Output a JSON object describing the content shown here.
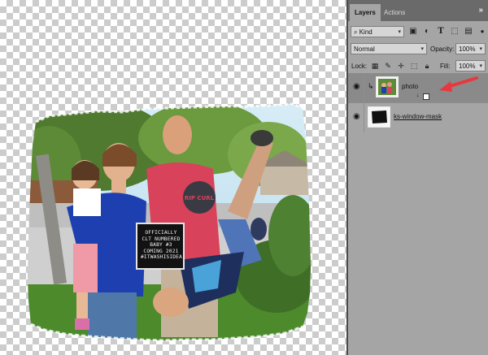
{
  "letterboard": {
    "lines": [
      "OFFICIALLY",
      "CLT NUMBERED",
      "BABY #3",
      "COMING 2021",
      "#ITWASHISIDEA"
    ]
  },
  "panel": {
    "tabs": [
      {
        "label": "Layers"
      },
      {
        "label": "Actions"
      }
    ],
    "menu_glyph": "»",
    "filter": {
      "value": "Kind",
      "icons": [
        "image-filter-icon",
        "adjustment-filter-icon",
        "type-filter-icon",
        "shape-filter-icon",
        "smartobject-filter-icon"
      ]
    },
    "blend_mode": "Normal",
    "opacity": {
      "label": "Opacity:",
      "value": "100%"
    },
    "lock": {
      "label": "Lock:",
      "icons": [
        "lock-transparent-icon",
        "lock-paint-icon",
        "lock-move-icon",
        "lock-artboard-icon",
        "lock-all-icon"
      ]
    },
    "fill": {
      "label": "Fill:",
      "value": "100%"
    },
    "layers": [
      {
        "name": "photo",
        "selected": true,
        "clipped": true,
        "has_mask": true
      },
      {
        "name": "ks-window-mask",
        "selected": false,
        "clipped": false,
        "has_mask": false
      }
    ]
  },
  "colors": {
    "annotation_arrow": "#e8383d",
    "panel_bg": "#a5a5a5",
    "selected_row": "#8a8a8a",
    "shirt_red": "#d8425a",
    "top_blue": "#1d3fb0"
  }
}
